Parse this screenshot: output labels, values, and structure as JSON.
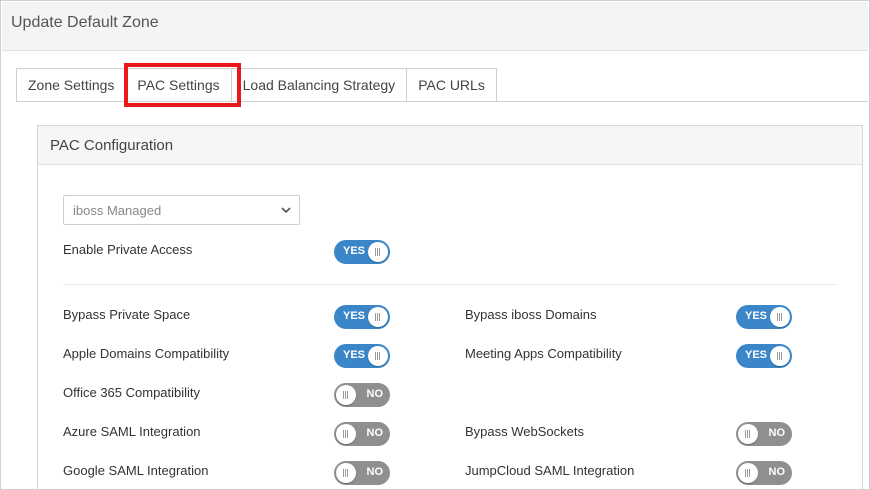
{
  "header": {
    "title": "Update Default Zone"
  },
  "tabs": [
    {
      "label": "Zone Settings",
      "active": false
    },
    {
      "label": "PAC Settings",
      "active": true
    },
    {
      "label": "Load Balancing Strategy",
      "active": false
    },
    {
      "label": "PAC URLs",
      "active": false
    }
  ],
  "highlight_color": "#e8191c",
  "panel": {
    "title": "PAC Configuration",
    "mode_select": {
      "value": "iboss Managed"
    },
    "private_access": {
      "label": "Enable Private Access",
      "state": "YES"
    },
    "settings": [
      {
        "label": "Bypass Private Space",
        "state": "YES"
      },
      {
        "label": "Bypass iboss Domains",
        "state": "YES"
      },
      {
        "label": "Apple Domains Compatibility",
        "state": "YES"
      },
      {
        "label": "Meeting Apps Compatibility",
        "state": "YES"
      },
      {
        "label": "Office 365 Compatibility",
        "state": "NO"
      },
      {
        "label": "Azure SAML Integration",
        "state": "NO"
      },
      {
        "label": "Bypass WebSockets",
        "state": "NO"
      },
      {
        "label": "Google SAML Integration",
        "state": "NO"
      },
      {
        "label": "JumpCloud SAML Integration",
        "state": "NO"
      }
    ]
  },
  "colors": {
    "toggle_on": "#3a86c8",
    "toggle_off": "#8f8f8f"
  }
}
